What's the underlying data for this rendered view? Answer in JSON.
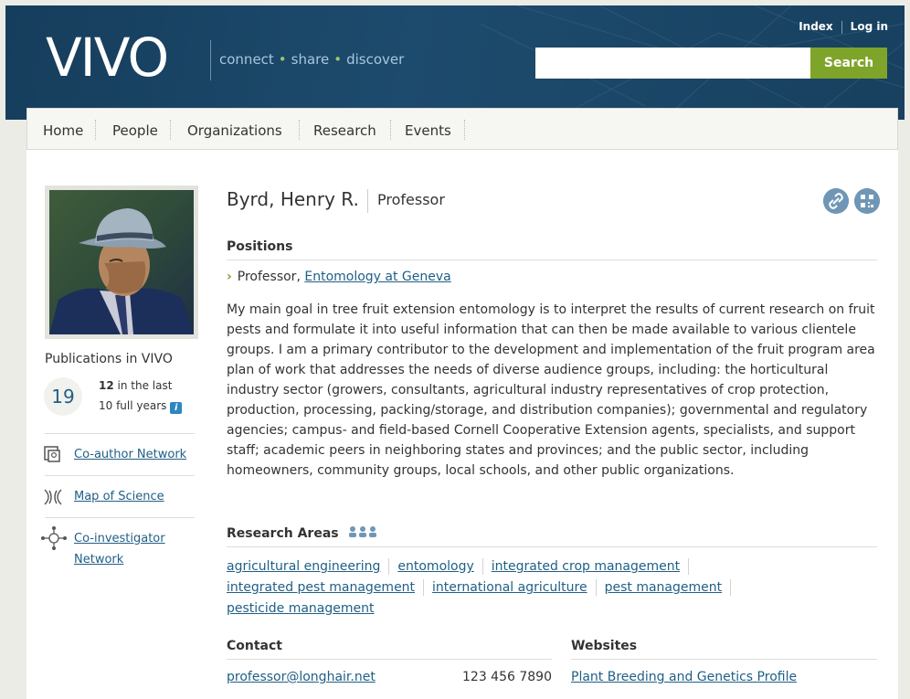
{
  "header": {
    "logo": "VIVO",
    "tagline": [
      "connect",
      "share",
      "discover"
    ],
    "top_links": {
      "index": "Index",
      "login": "Log in"
    },
    "search": {
      "value": "",
      "placeholder": "",
      "button": "Search"
    }
  },
  "nav": {
    "items": [
      "Home",
      "People",
      "Organizations",
      "Research",
      "Events"
    ]
  },
  "profile": {
    "name": "Byrd, Henry R.",
    "title": "Professor",
    "photo_icon": "portrait-photo",
    "icons": {
      "share": "link-icon",
      "qr": "qr-code-icon"
    }
  },
  "sidebar": {
    "publications_title": "Publications in VIVO",
    "publications_count": "19",
    "last_count": "12",
    "last_text": "in the last",
    "years_text": "10 full years",
    "info_icon": "i",
    "links": {
      "coauthor": "Co-author Network",
      "map": "Map of Science",
      "coinvestigator_1": "Co-investigator",
      "coinvestigator_2": "Network"
    }
  },
  "positions": {
    "heading": "Positions",
    "role": "Professor,",
    "org": "Entomology at Geneva"
  },
  "overview": "My main goal in tree fruit extension entomology is to interpret the results of current research on fruit pests and formulate it into useful information that can then be made available to various clientele groups. I am a primary contributor to the development and implementation of the fruit program area plan of work that addresses the needs of diverse audience groups, including: the horticultural industry sector (growers, consultants, agricultural industry representatives of crop protection, production, processing, packing/storage, and distribution companies); governmental and regulatory agencies; campus- and field-based Cornell Cooperative Extension agents, specialists, and support staff; academic peers in neighboring states and provinces; and the public sector, including homeowners, community groups, local schools, and other public organizations.",
  "research_areas": {
    "heading": "Research Areas",
    "items": [
      "agricultural engineering",
      "entomology",
      "integrated crop management",
      "integrated pest management",
      "international agriculture",
      "pest management",
      "pesticide management"
    ]
  },
  "contact": {
    "heading": "Contact",
    "email": "professor@longhair.net",
    "phone": "123 456 7890"
  },
  "websites": {
    "heading": "Websites",
    "link": "Plant Breeding and Genetics Profile"
  },
  "colors": {
    "header_bg": "#1b4669",
    "accent_green": "#7fa42a",
    "link": "#1f5f86",
    "page_bg": "#ecece7"
  }
}
